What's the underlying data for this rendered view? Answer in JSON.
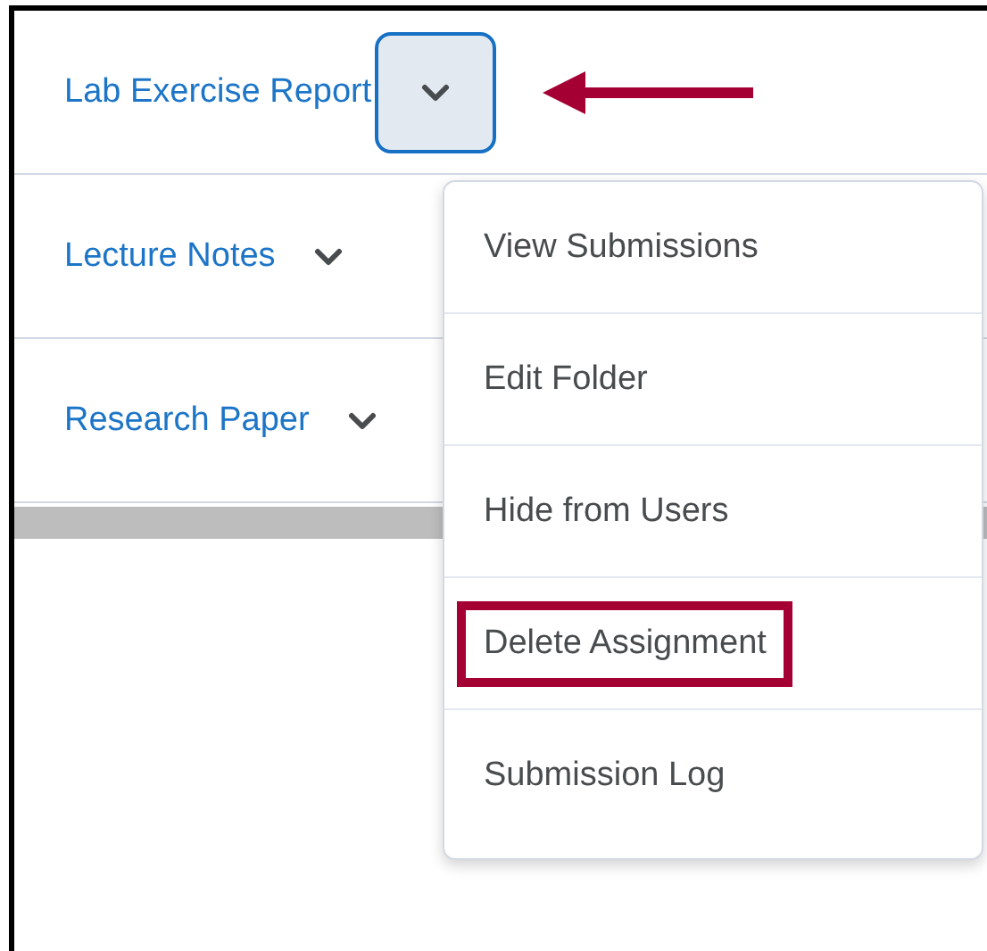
{
  "rows": [
    {
      "title": "Lab Exercise Report",
      "menu_expanded": true
    },
    {
      "title": "Lecture Notes",
      "menu_expanded": false
    },
    {
      "title": "Research Paper",
      "menu_expanded": false
    }
  ],
  "menu": {
    "items": [
      {
        "label": "View Submissions",
        "highlighted": false
      },
      {
        "label": "Edit Folder",
        "highlighted": false
      },
      {
        "label": "Hide from Users",
        "highlighted": false
      },
      {
        "label": "Delete Assignment",
        "highlighted": true
      },
      {
        "label": "Submission Log",
        "highlighted": false
      }
    ]
  }
}
